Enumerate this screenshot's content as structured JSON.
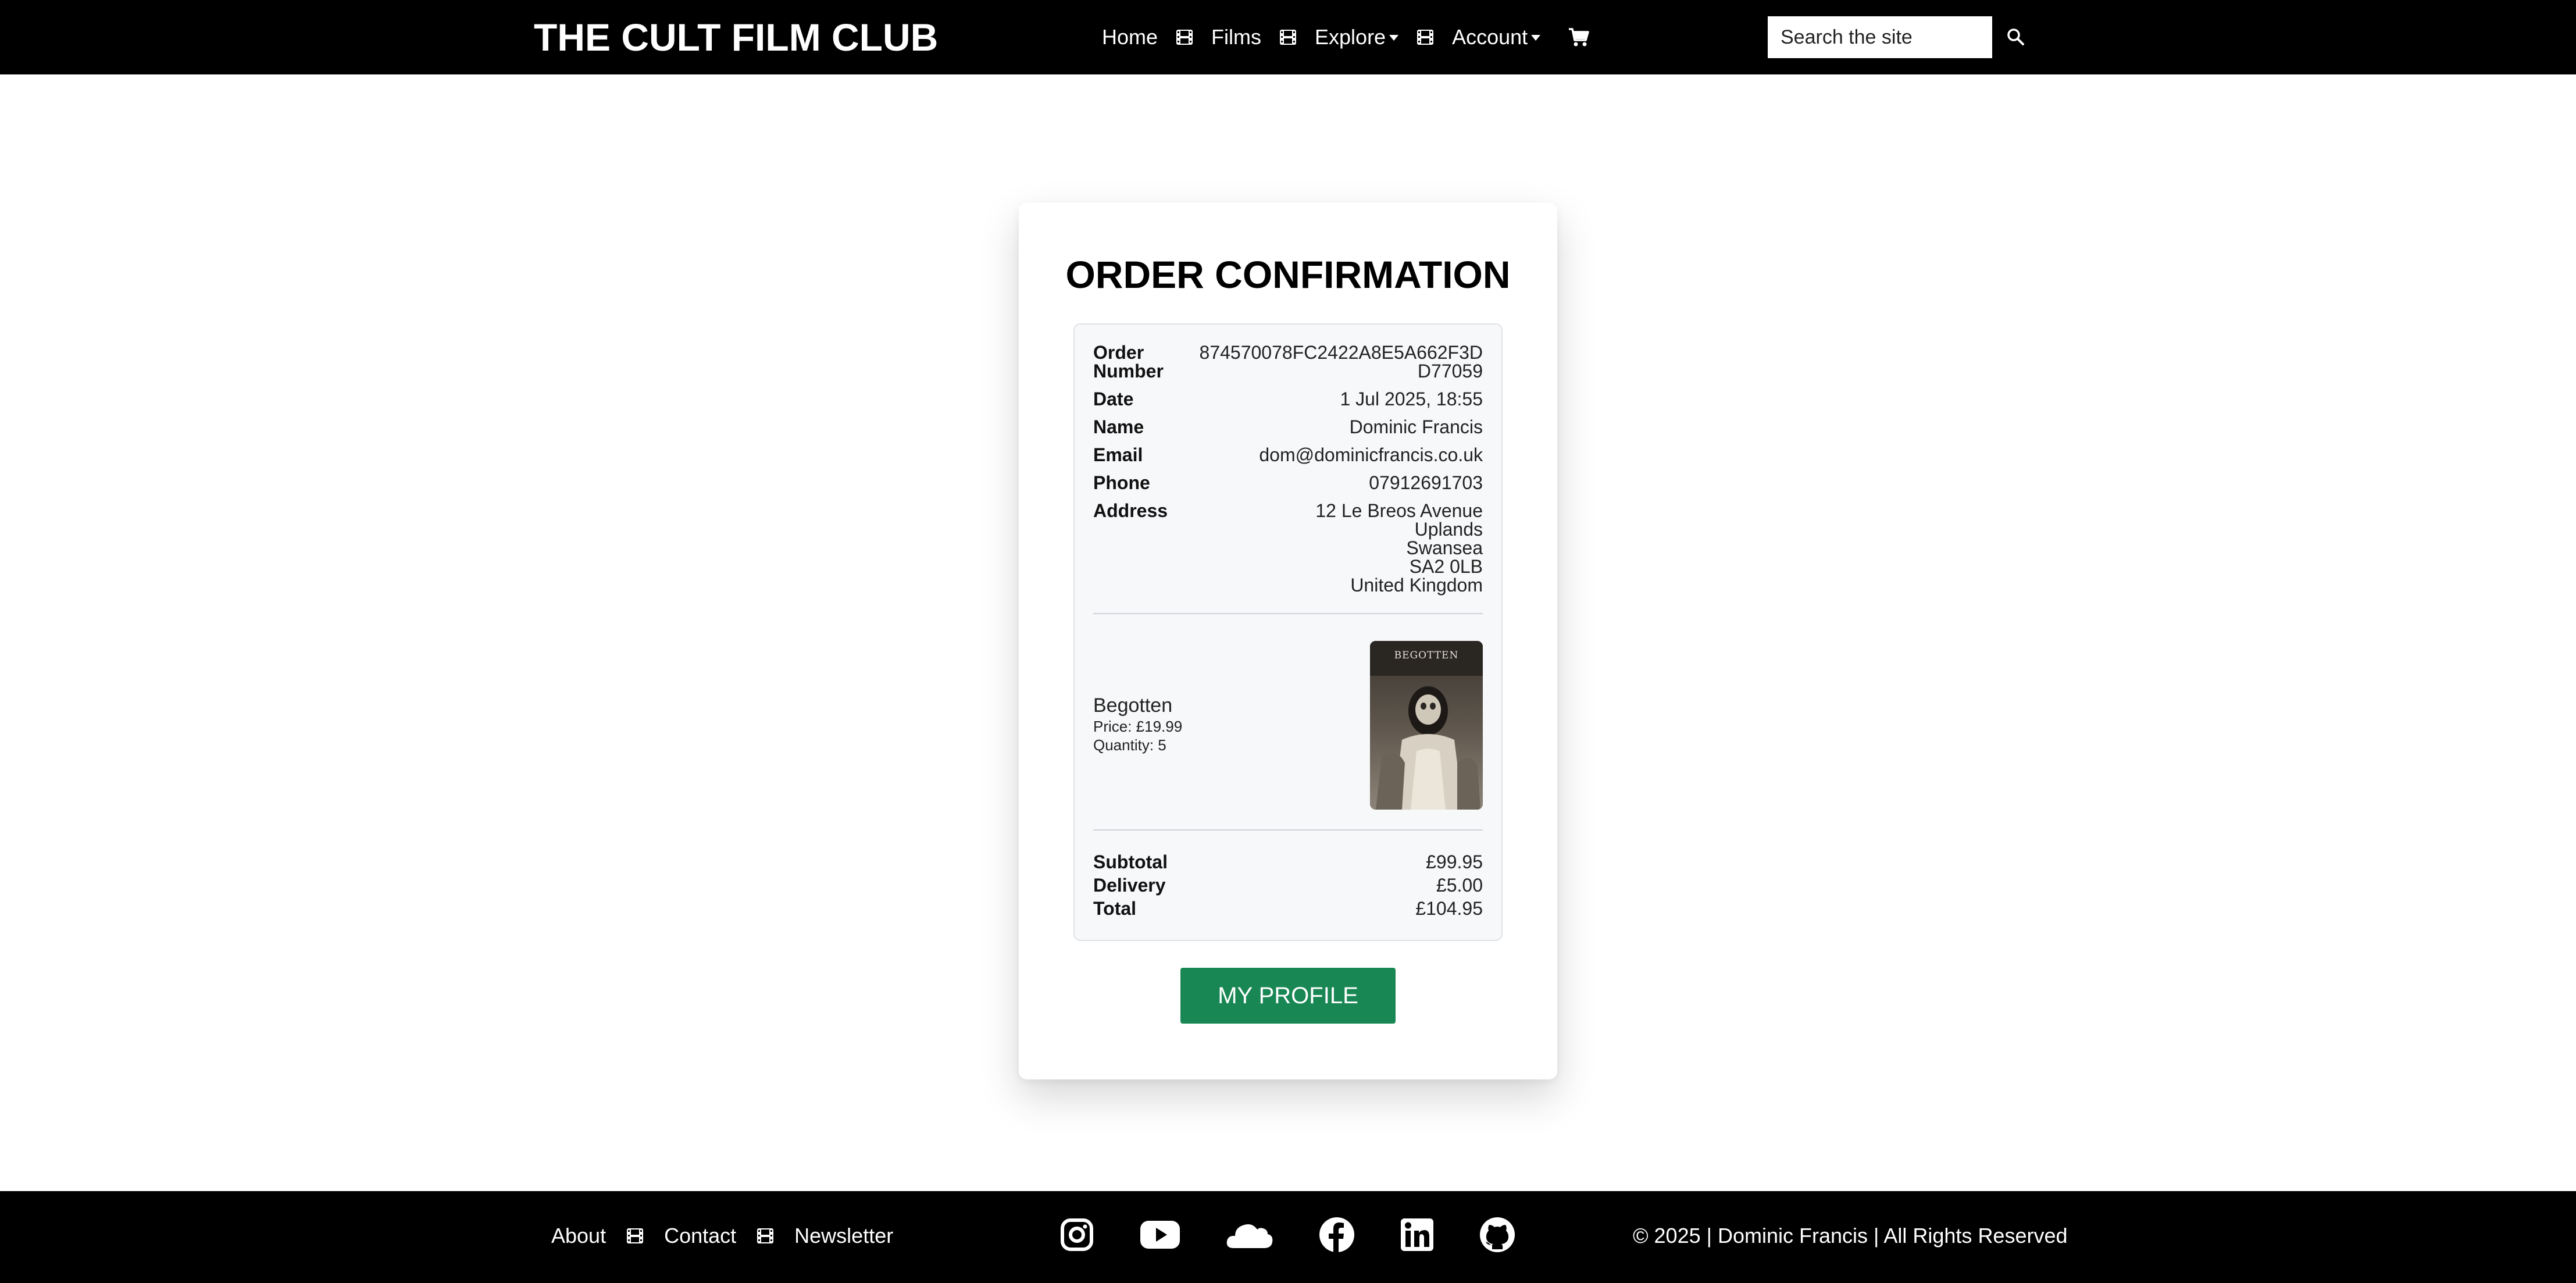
{
  "header": {
    "brand": "THE CULT FILM CLUB",
    "nav": {
      "home": "Home",
      "films": "Films",
      "explore": "Explore",
      "account": "Account"
    },
    "search_placeholder": "Search the site"
  },
  "order": {
    "title": "ORDER CONFIRMATION",
    "labels": {
      "order_number_1": "Order",
      "order_number_2": "Number",
      "date": "Date",
      "name": "Name",
      "email": "Email",
      "phone": "Phone",
      "address": "Address",
      "subtotal": "Subtotal",
      "delivery": "Delivery",
      "total": "Total"
    },
    "order_number_line1": "874570078FC2422A8E5A662F3D",
    "order_number_line2": "D77059",
    "date": "1 Jul 2025, 18:55",
    "name": "Dominic Francis",
    "email": "dom@dominicfrancis.co.uk",
    "phone": "07912691703",
    "address": [
      "12 Le Breos Avenue",
      "Uplands",
      "Swansea",
      "SA2 0LB",
      "United Kingdom"
    ],
    "item": {
      "title": "Begotten",
      "price": "Price: £19.99",
      "quantity": "Quantity: 5",
      "poster_text": "BEGOTTEN"
    },
    "subtotal": "£99.95",
    "delivery": "£5.00",
    "total": "£104.95",
    "button": "MY PROFILE"
  },
  "footer": {
    "about": "About",
    "contact": "Contact",
    "newsletter": "Newsletter",
    "social_icons": [
      "instagram-icon",
      "youtube-icon",
      "soundcloud-icon",
      "facebook-icon",
      "linkedin-icon",
      "github-icon"
    ],
    "copyright": "© 2025 | Dominic Francis | All Rights Reserved"
  },
  "colors": {
    "header_bg": "#000000",
    "button_green": "#198754",
    "order_box_bg": "#f7f8fa"
  }
}
